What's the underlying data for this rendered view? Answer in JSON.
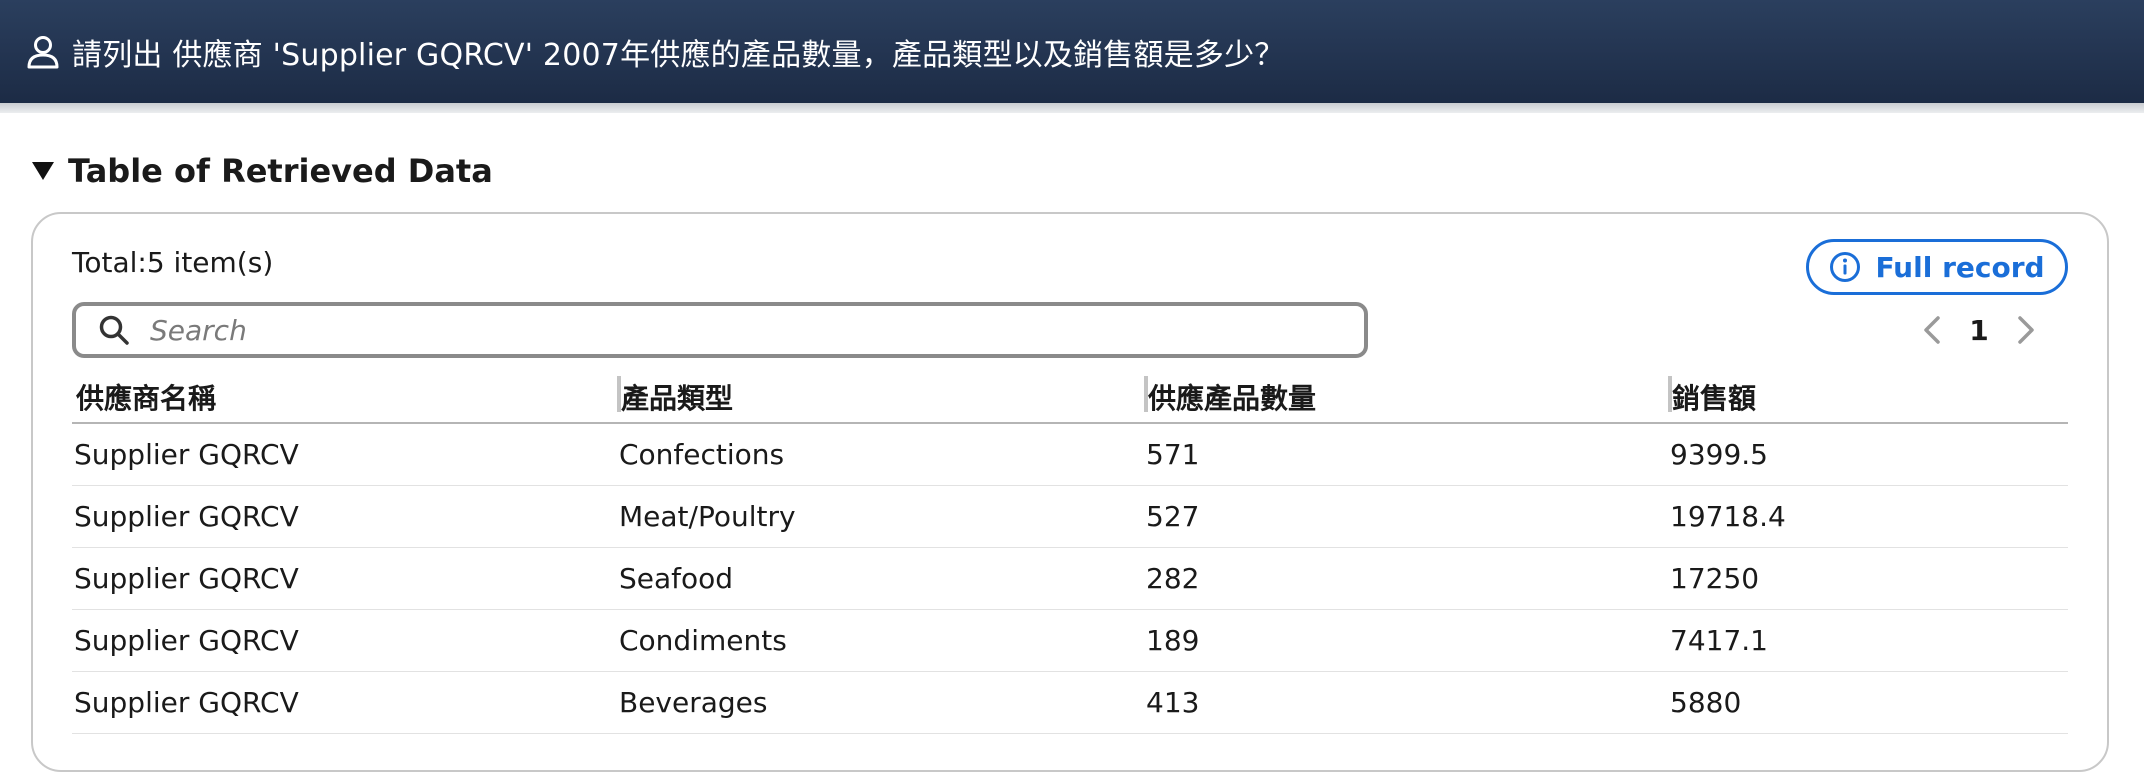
{
  "header": {
    "question": "請列出 供應商 'Supplier GQRCV' 2007年供應的產品數量，產品類型以及銷售額是多少？"
  },
  "section": {
    "title": "Table of Retrieved Data"
  },
  "table_panel": {
    "total_label": "Total:5 item(s)",
    "full_record_label": "Full record",
    "search_placeholder": "Search",
    "current_page": "1",
    "columns": [
      "供應商名稱",
      "產品類型",
      "供應產品數量",
      "銷售額"
    ],
    "rows": [
      [
        "Supplier GQRCV",
        "Confections",
        "571",
        "9399.5"
      ],
      [
        "Supplier GQRCV",
        "Meat/Poultry",
        "527",
        "19718.4"
      ],
      [
        "Supplier GQRCV",
        "Seafood",
        "282",
        "17250"
      ],
      [
        "Supplier GQRCV",
        "Condiments",
        "189",
        "7417.1"
      ],
      [
        "Supplier GQRCV",
        "Beverages",
        "413",
        "5880"
      ]
    ]
  },
  "icons": {
    "user": "user-icon",
    "toggle": "triangle-down-icon",
    "info": "info-icon",
    "search": "search-icon",
    "prev": "chevron-left-icon",
    "next": "chevron-right-icon"
  },
  "colors": {
    "banner": "#223552",
    "accent": "#1a6ed8"
  }
}
